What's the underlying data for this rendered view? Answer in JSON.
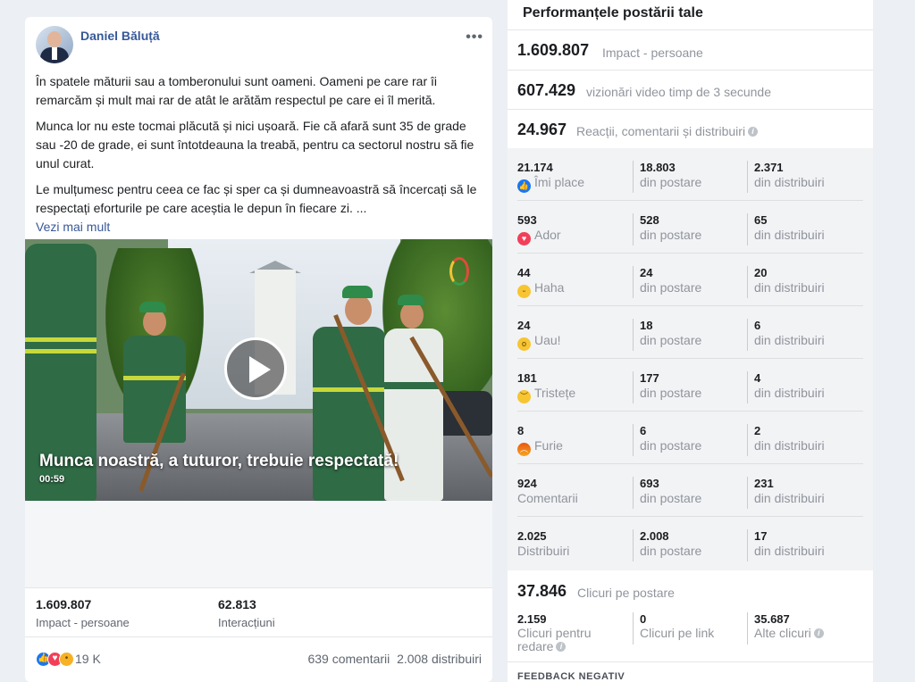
{
  "post": {
    "author": "Daniel Băluță",
    "menu": "•••",
    "paragraphs": [
      "În spatele măturii sau a tomberonului sunt oameni. Oameni pe care rar îi remarcăm și mult mai rar de atât le arătăm respectul pe care ei îl merită.",
      "Munca lor nu este tocmai plăcută și nici ușoară. Fie că afară sunt 35 de grade sau -20 de grade, ei sunt întotdeauna la treabă, pentru ca sectorul nostru să fie unul curat.",
      "Le mulțumesc pentru ceea ce fac și sper ca și dumneavoastră să încercați să le respectați eforturile pe care aceștia le depun în fiecare zi. ..."
    ],
    "see_more": "Vezi mai mult",
    "video": {
      "title": "Munca noastră, a tuturor, trebuie respectată!",
      "duration": "00:59"
    },
    "stats": [
      {
        "value": "1.609.807",
        "label": "Impact - persoane"
      },
      {
        "value": "62.813",
        "label": "Interacțiuni"
      }
    ],
    "reaction_count": "19 K",
    "comments": "639 comentarii",
    "shares": "2.008 distribuiri"
  },
  "panel": {
    "title": "Performanțele postării tale",
    "reach": {
      "value": "1.609.807",
      "label": "Impact - persoane"
    },
    "views": {
      "value": "607.429",
      "label": "vizionări video timp de 3 secunde"
    },
    "engagement": {
      "value": "24.967",
      "label": "Reacții, comentarii și distribuiri"
    },
    "breakdown": [
      {
        "total": "21.174",
        "label": "Îmi place",
        "emoji": "like-icon",
        "post": "18.803",
        "shares": "2.371"
      },
      {
        "total": "593",
        "label": "Ador",
        "emoji": "love-icon",
        "post": "528",
        "shares": "65"
      },
      {
        "total": "44",
        "label": "Haha",
        "emoji": "haha-icon",
        "post": "24",
        "shares": "20"
      },
      {
        "total": "24",
        "label": "Uau!",
        "emoji": "wow-icon",
        "post": "18",
        "shares": "6"
      },
      {
        "total": "181",
        "label": "Tristețe",
        "emoji": "sad-icon",
        "post": "177",
        "shares": "4"
      },
      {
        "total": "8",
        "label": "Furie",
        "emoji": "angry-icon",
        "post": "6",
        "shares": "2"
      },
      {
        "total": "924",
        "label": "Comentarii",
        "emoji": "",
        "post": "693",
        "shares": "231"
      },
      {
        "total": "2.025",
        "label": "Distribuiri",
        "emoji": "",
        "post": "2.008",
        "shares": "17"
      }
    ],
    "from_post": "din postare",
    "from_shares": "din distribuiri",
    "clicks": {
      "value": "37.846",
      "label": "Clicuri pe postare"
    },
    "click_breakdown": [
      {
        "value": "2.159",
        "label": "Clicuri pentru redare"
      },
      {
        "value": "0",
        "label": "Clicuri pe link"
      },
      {
        "value": "35.687",
        "label": "Alte clicuri"
      }
    ],
    "negative_feedback": "FEEDBACK NEGATIV"
  },
  "colors": {
    "link": "#385898",
    "like": "#1877f2",
    "love": "#f33e58",
    "muted": "#90949c"
  }
}
